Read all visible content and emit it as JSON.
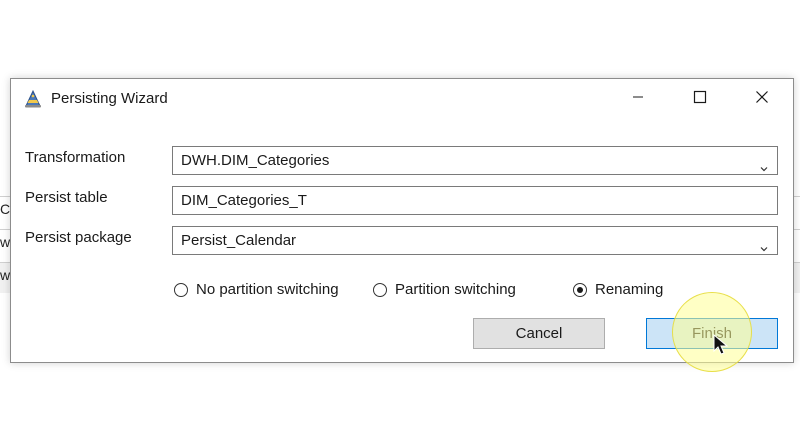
{
  "background": {
    "fragments": [
      "C",
      "w",
      "w"
    ]
  },
  "dialog": {
    "title": "Persisting Wizard",
    "title_icon": "wizard-hat-icon",
    "window_controls": {
      "minimize": "minimize-icon",
      "maximize": "maximize-icon",
      "close": "close-icon"
    },
    "fields": {
      "transformation": {
        "label": "Transformation",
        "value": "DWH.DIM_Categories",
        "type": "dropdown"
      },
      "persist_table": {
        "label": "Persist table",
        "value": "DIM_Categories_T",
        "type": "text"
      },
      "persist_package": {
        "label": "Persist package",
        "value": "Persist_Calendar",
        "type": "dropdown"
      }
    },
    "options": [
      {
        "label": "No partition switching",
        "selected": false
      },
      {
        "label": "Partition switching",
        "selected": false
      },
      {
        "label": "Renaming",
        "selected": true
      }
    ],
    "buttons": {
      "cancel": "Cancel",
      "finish": "Finish"
    },
    "colors": {
      "accent": "#0078d7",
      "finish_bg": "#cce4f7",
      "cancel_bg": "#e1e1e1",
      "click_highlight": "#ffff96"
    }
  }
}
